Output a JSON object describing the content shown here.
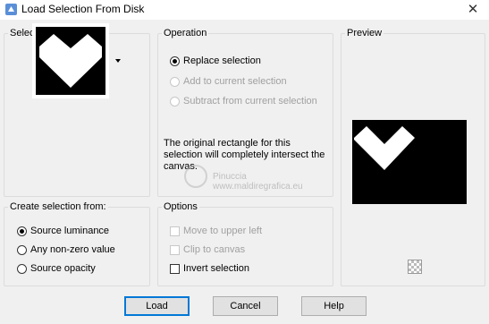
{
  "window": {
    "title": "Load Selection From Disk",
    "close_glyph": "✕"
  },
  "selection_group": {
    "label": "Selection",
    "thumbnail": "selection-heart-thumbnail"
  },
  "operation_group": {
    "label": "Operation",
    "options": [
      {
        "label": "Replace selection",
        "selected": true,
        "enabled": true
      },
      {
        "label": "Add to current selection",
        "selected": false,
        "enabled": false
      },
      {
        "label": "Subtract from current selection",
        "selected": false,
        "enabled": false
      }
    ],
    "message": "The original rectangle for this selection will completely intersect the canvas."
  },
  "preview_group": {
    "label": "Preview"
  },
  "create_group": {
    "label": "Create selection from:",
    "options": [
      {
        "label": "Source luminance",
        "selected": true
      },
      {
        "label": "Any non-zero value",
        "selected": false
      },
      {
        "label": "Source opacity",
        "selected": false
      }
    ]
  },
  "options_group": {
    "label": "Options",
    "items": [
      {
        "label": "Move to upper left",
        "checked": false,
        "enabled": false
      },
      {
        "label": "Clip to canvas",
        "checked": false,
        "enabled": false
      },
      {
        "label": "Invert selection",
        "checked": false,
        "enabled": true
      }
    ]
  },
  "buttons": {
    "load": "Load",
    "cancel": "Cancel",
    "help": "Help"
  },
  "watermark": {
    "line1": "Pinuccia",
    "line2": "www.maldiregrafica.eu"
  },
  "colors": {
    "dialog_bg": "#f0f0f0",
    "group_border": "#dcdcdc",
    "accent": "#0078d7",
    "disabled_text": "#a0a0a0"
  }
}
